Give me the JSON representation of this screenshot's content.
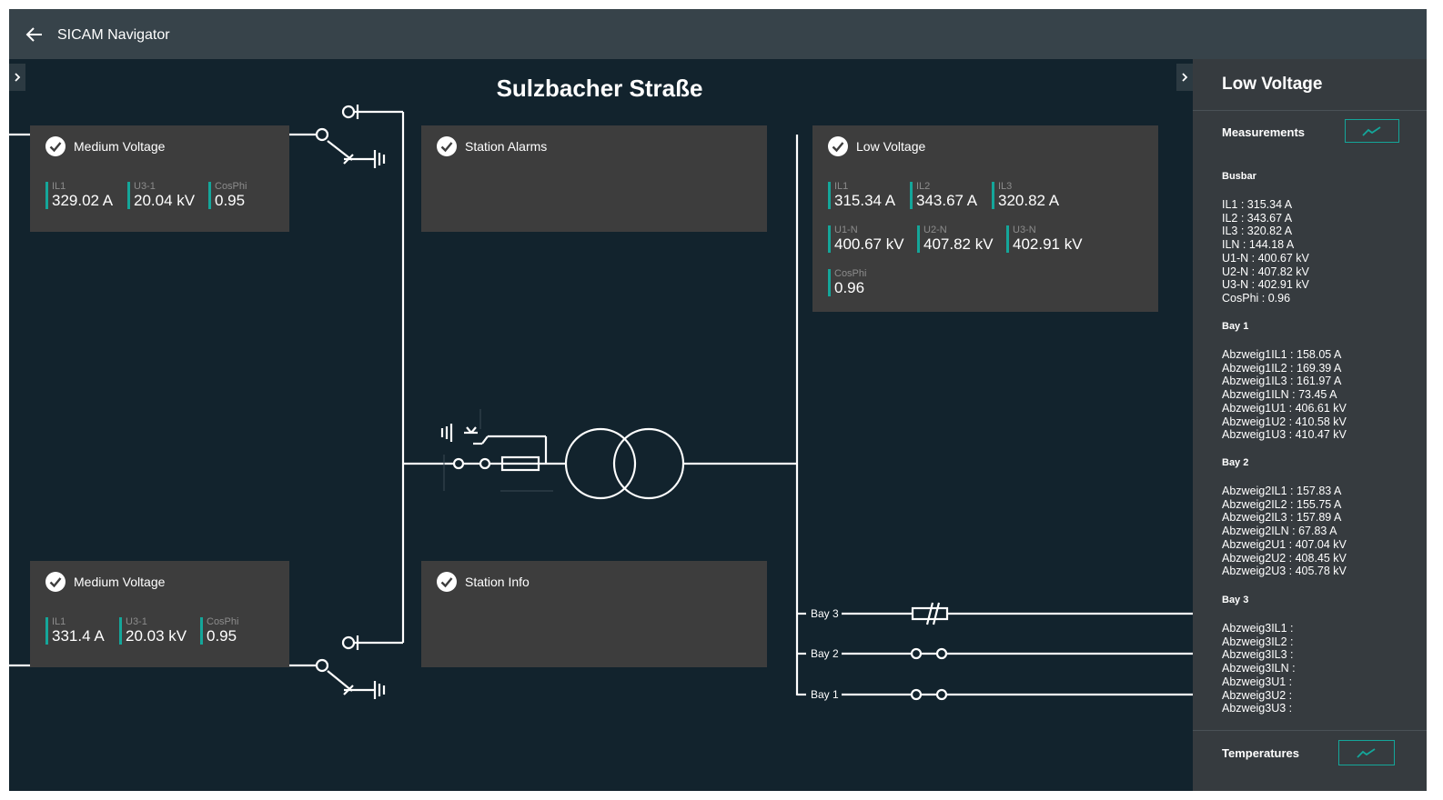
{
  "app": {
    "title": "SICAM Navigator",
    "accent_color": "#14a69a",
    "background_color": "#12232d",
    "panel_color": "#363b3f",
    "card_color": "#3d3d3d"
  },
  "station": {
    "title": "Sulzbacher Straße"
  },
  "cards": {
    "mv_top": {
      "title": "Medium Voltage",
      "status_icon": "check-circle-icon",
      "measurements": [
        {
          "label": "IL1",
          "value": "329.02 A"
        },
        {
          "label": "U3-1",
          "value": "20.04 kV"
        },
        {
          "label": "CosPhi",
          "value": "0.95"
        }
      ]
    },
    "alarms": {
      "title": "Station Alarms",
      "status_icon": "check-circle-icon"
    },
    "lv": {
      "title": "Low Voltage",
      "status_icon": "check-circle-icon",
      "currents": [
        {
          "label": "IL1",
          "value": "315.34 A"
        },
        {
          "label": "IL2",
          "value": "343.67 A"
        },
        {
          "label": "IL3",
          "value": "320.82 A"
        }
      ],
      "voltages": [
        {
          "label": "U1-N",
          "value": "400.67 kV"
        },
        {
          "label": "U2-N",
          "value": "407.82 kV"
        },
        {
          "label": "U3-N",
          "value": "402.91 kV"
        }
      ],
      "cosphi": {
        "label": "CosPhi",
        "value": "0.96"
      }
    },
    "mv_bottom": {
      "title": "Medium Voltage",
      "status_icon": "check-circle-icon",
      "measurements": [
        {
          "label": "IL1",
          "value": "331.4 A"
        },
        {
          "label": "U3-1",
          "value": "20.03 kV"
        },
        {
          "label": "CosPhi",
          "value": "0.95"
        }
      ]
    },
    "info": {
      "title": "Station Info",
      "status_icon": "check-circle-icon"
    }
  },
  "bays": [
    "Bay 3",
    "Bay 2",
    "Bay 1"
  ],
  "panel": {
    "title": "Low Voltage",
    "measurements_label": "Measurements",
    "temperatures_label": "Temperatures",
    "trend_icon": "trend-chart-icon",
    "groups": [
      {
        "title": "Busbar",
        "items": [
          "IL1 : 315.34 A",
          "IL2 : 343.67 A",
          "IL3 : 320.82 A",
          "ILN : 144.18 A",
          "U1-N : 400.67 kV",
          "U2-N : 407.82 kV",
          "U3-N : 402.91 kV",
          "CosPhi : 0.96"
        ]
      },
      {
        "title": "Bay 1",
        "items": [
          "Abzweig1IL1 : 158.05 A",
          "Abzweig1IL2 : 169.39 A",
          "Abzweig1IL3 : 161.97 A",
          "Abzweig1ILN : 73.45 A",
          "Abzweig1U1 : 406.61 kV",
          "Abzweig1U2 : 410.58 kV",
          "Abzweig1U3 : 410.47 kV"
        ]
      },
      {
        "title": "Bay 2",
        "items": [
          "Abzweig2IL1 : 157.83 A",
          "Abzweig2IL2 : 155.75 A",
          "Abzweig2IL3 : 157.89 A",
          "Abzweig2ILN : 67.83 A",
          "Abzweig2U1 : 407.04 kV",
          "Abzweig2U2 : 408.45 kV",
          "Abzweig2U3 : 405.78 kV"
        ]
      },
      {
        "title": "Bay 3",
        "items": [
          "Abzweig3IL1 :",
          "Abzweig3IL2 :",
          "Abzweig3IL3 :",
          "Abzweig3ILN :",
          "Abzweig3U1 :",
          "Abzweig3U2 :",
          "Abzweig3U3 :"
        ]
      }
    ]
  }
}
